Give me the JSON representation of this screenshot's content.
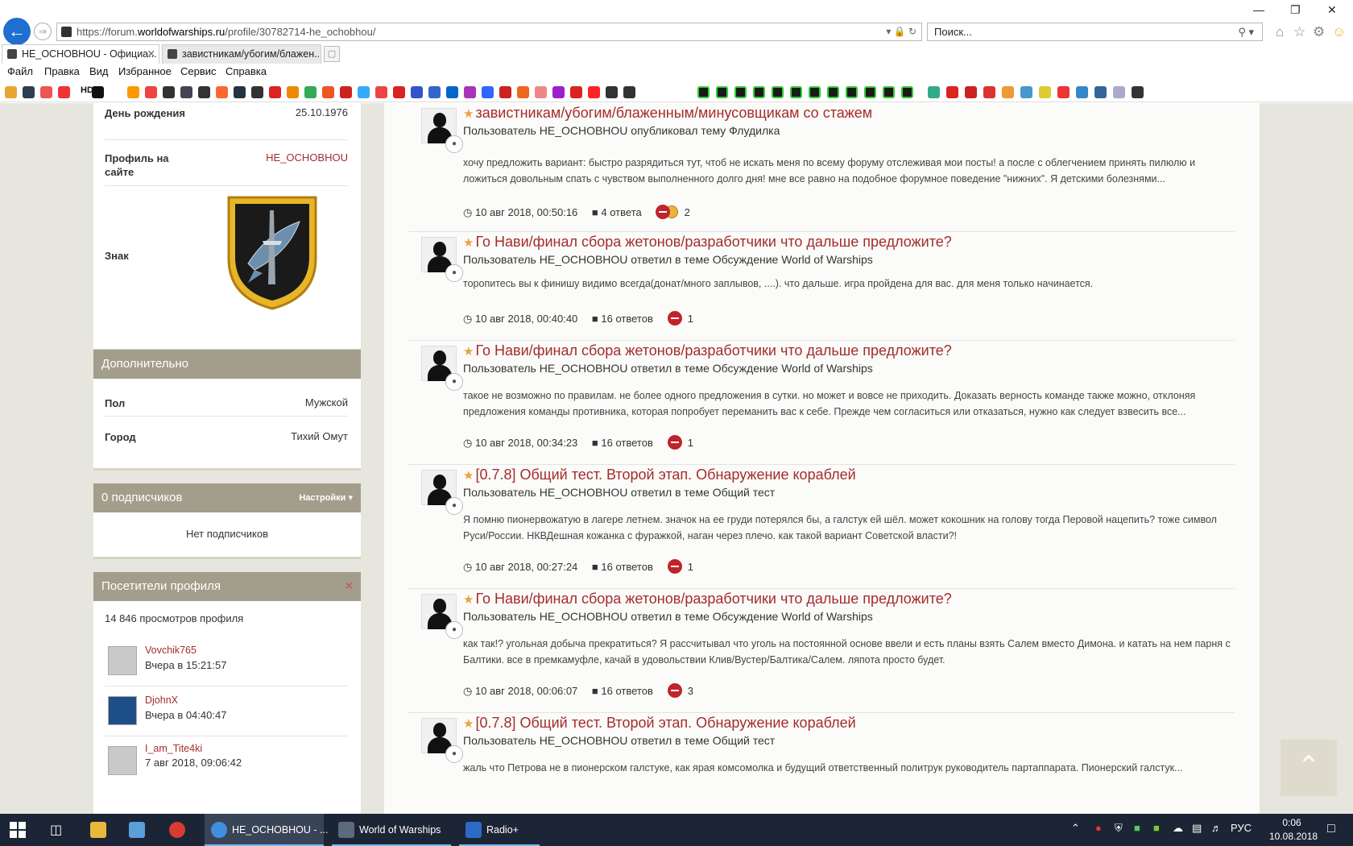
{
  "browser": {
    "url_prefix": "https://forum.",
    "url_domain": "worldofwarships.ru",
    "url_path": "/profile/30782714-he_ochobhou/",
    "search_placeholder": "Поиск...",
    "tabs": [
      {
        "label": "HE_OCHOBHOU - Официа...",
        "active": true
      },
      {
        "label": "завистникам/убогим/блажен...",
        "active": false
      }
    ],
    "menu": [
      "Файл",
      "Правка",
      "Вид",
      "Избранное",
      "Сервис",
      "Справка"
    ],
    "fav_hd_label": "HD"
  },
  "profile": {
    "birthday_label": "День рождения",
    "birthday_value": "25.10.1976",
    "site_label": "Профиль на сайте",
    "site_value": "HE_OCHOBHOU",
    "badge_label": "Знак"
  },
  "additional": {
    "title": "Дополнительно",
    "gender_label": "Пол",
    "gender_value": "Мужской",
    "city_label": "Город",
    "city_value": "Тихий Омут"
  },
  "followers": {
    "title": "0 подписчиков",
    "settings_label": "Настройки ▾",
    "empty_text": "Нет подписчиков"
  },
  "visitors": {
    "title": "Посетители профиля",
    "close_label": "×",
    "views": "14 846 просмотров профиля",
    "list": [
      {
        "name": "Vovchik765",
        "time": "Вчера в 15:21:57"
      },
      {
        "name": "DjohnX",
        "time": "Вчера в 04:40:47"
      },
      {
        "name": "I_am_Tite4ki",
        "time": "7 авг 2018, 09:06:42"
      }
    ]
  },
  "posts": [
    {
      "title": "завистникам/убогим/блаженным/минусовщикам со стажем",
      "subtitle": "Пользователь HE_OCHOBHOU опубликовал тему Флудилка",
      "text": "хочу предложить вариант: быстро разрядиться тут, чтоб не искать меня по всему форуму отслеживая мои посты! а после с облегчением принять пилюлю и ложиться довольным спать с чувством выполненного долго дня! мне все равно на подобное форумное поведение \"нижних\". Я детскими болезнями...",
      "date": "10 авг 2018, 00:50:16",
      "replies": "4 ответа",
      "reactions": "2"
    },
    {
      "title": "Го Нави/финал сбора жетонов/разработчики что дальше предложите?",
      "subtitle": "Пользователь HE_OCHOBHOU ответил в теме Обсуждение World of Warships",
      "text": "торопитесь вы к финишу видимо всегда(донат/много заплывов, ....). что дальше. игра пройдена для вас. для меня только начинается.",
      "date": "10 авг 2018, 00:40:40",
      "replies": "16 ответов",
      "reactions": "1"
    },
    {
      "title": "Го Нави/финал сбора жетонов/разработчики что дальше предложите?",
      "subtitle": "Пользователь HE_OCHOBHOU ответил в теме Обсуждение World of Warships",
      "text": "такое не возможно по правилам. не более одного предложения в сутки. но может и вовсе не приходить. Доказать верность команде также можно, отклоняя предложения команды противника, которая попробует переманить вас к себе. Прежде чем согласиться или отказаться, нужно как следует взвесить все...",
      "date": "10 авг 2018, 00:34:23",
      "replies": "16 ответов",
      "reactions": "1"
    },
    {
      "title": "[0.7.8] Общий тест. Второй этап. Обнаружение кораблей",
      "subtitle": "Пользователь HE_OCHOBHOU ответил в теме Общий тест",
      "text": "Я помню пионервожатую в лагере летнем. значок на ее груди потерялся бы, а галстук ей шёл. может кокошник на голову тогда Перовой нацепить? тоже символ Руси/России. НКВДешная кожанка с фуражкой, наган через плечо. как такой вариант Советской власти?!",
      "date": "10 авг 2018, 00:27:24",
      "replies": "16 ответов",
      "reactions": "1"
    },
    {
      "title": "Го Нави/финал сбора жетонов/разработчики что дальше предложите?",
      "subtitle": "Пользователь HE_OCHOBHOU ответил в теме Обсуждение World of Warships",
      "text": "как так!? угольная добыча прекратиться? Я рассчитывал что уголь на постоянной основе ввели и есть планы взять Салем вместо Димона. и катать на нем парня с Балтики. все в премкамуфле, качай в удовольствии Клив/Вустер/Балтика/Салем. ляпота просто будет.",
      "date": "10 авг 2018, 00:06:07",
      "replies": "16 ответов",
      "reactions": "3"
    },
    {
      "title": "[0.7.8] Общий тест. Второй этап. Обнаружение кораблей",
      "subtitle": "Пользователь HE_OCHOBHOU ответил в теме Общий тест",
      "text": "жаль что Петрова не в пионерском галстуке, как ярая комсомолка и будущий ответственный политрук руководитель партаппарата. Пионерский галстук...",
      "date": "",
      "replies": "",
      "reactions": ""
    }
  ],
  "taskbar": {
    "items": [
      {
        "label": "HE_OCHOBHOU - ..."
      },
      {
        "label": "World of Warships"
      },
      {
        "label": "Radio+"
      }
    ],
    "lang": "РУС",
    "time": "0:06",
    "date": "10.08.2018"
  },
  "colors": {
    "accent_red": "#a32d2d",
    "panel_header": "#a39e8b",
    "taskbar": "#1c2535",
    "star": "#e8a33b"
  }
}
